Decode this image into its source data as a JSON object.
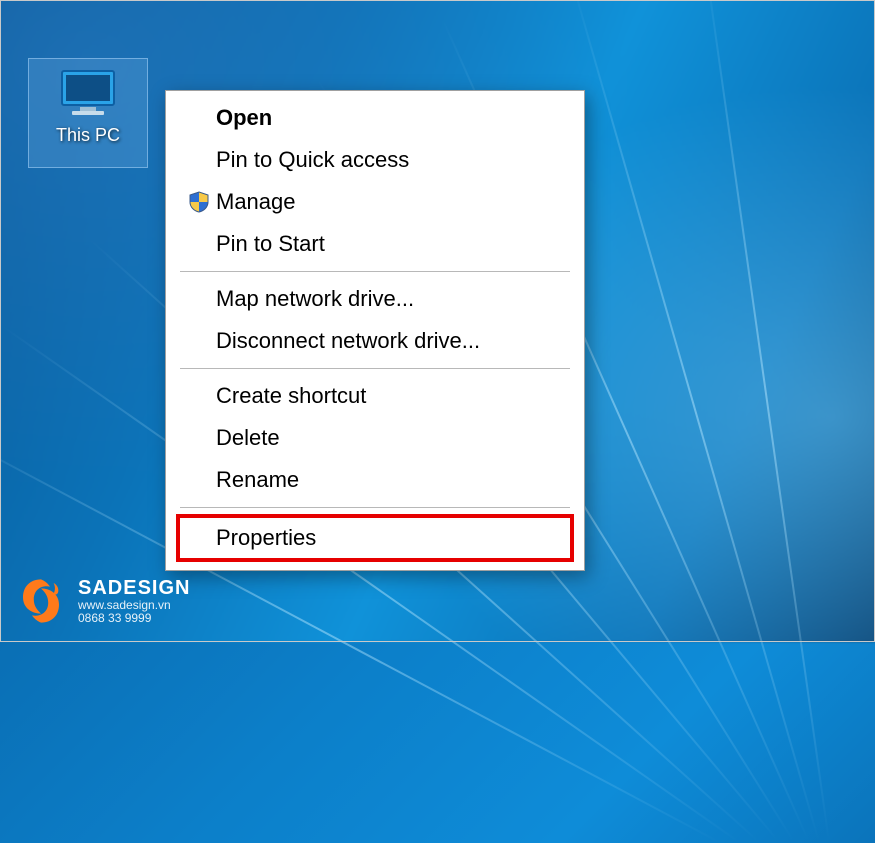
{
  "desktop": {
    "icon_label": "This PC"
  },
  "context_menu": {
    "items": [
      {
        "label": "Open",
        "bold": true
      },
      {
        "label": "Pin to Quick access"
      },
      {
        "label": "Manage",
        "icon": "shield"
      },
      {
        "label": "Pin to Start"
      }
    ],
    "group2": [
      {
        "label": "Map network drive..."
      },
      {
        "label": "Disconnect network drive..."
      }
    ],
    "group3": [
      {
        "label": "Create shortcut"
      },
      {
        "label": "Delete"
      },
      {
        "label": "Rename"
      }
    ],
    "group4": [
      {
        "label": "Properties",
        "highlighted": true
      }
    ]
  },
  "watermark": {
    "brand": "SADESIGN",
    "url": "www.sadesign.vn",
    "phone": "0868 33 9999"
  }
}
